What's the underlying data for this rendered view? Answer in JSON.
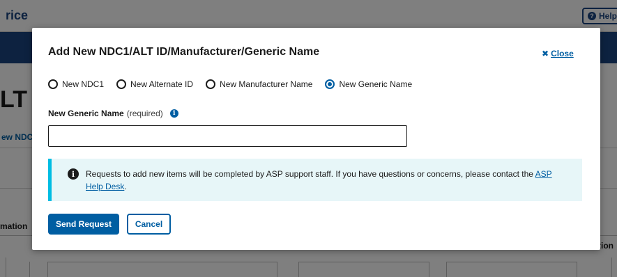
{
  "background": {
    "brand_fragment": "rice",
    "help_button": "Help",
    "help_icon": "question-circle-icon",
    "heading_fragment": "LT",
    "tab_fragment": "ew NDC",
    "column_fragment_left": "mation",
    "column_fragment_right": "tion"
  },
  "modal": {
    "title": "Add New NDC1/ALT ID/Manufacturer/Generic Name",
    "close_label": "Close",
    "close_icon": "close-icon",
    "radios": [
      {
        "label": "New NDC1",
        "checked": false
      },
      {
        "label": "New Alternate ID",
        "checked": false
      },
      {
        "label": "New Manufacturer Name",
        "checked": false
      },
      {
        "label": "New Generic Name",
        "checked": true
      }
    ],
    "field": {
      "label": "New Generic Name",
      "required_text": "(required)",
      "info_icon": "info-icon",
      "value": ""
    },
    "alert": {
      "icon": "info-circle-icon",
      "text": "Requests to add new items will be completed by ASP support staff. If you have questions or concerns, please contact the",
      "link_text": "ASP Help Desk",
      "suffix": "."
    },
    "buttons": {
      "send": "Send Request",
      "cancel": "Cancel"
    }
  },
  "colors": {
    "primary": "#005ea2",
    "navbar": "#1a4480",
    "alert_bg": "#e7f6f8",
    "alert_border": "#00bde3"
  }
}
